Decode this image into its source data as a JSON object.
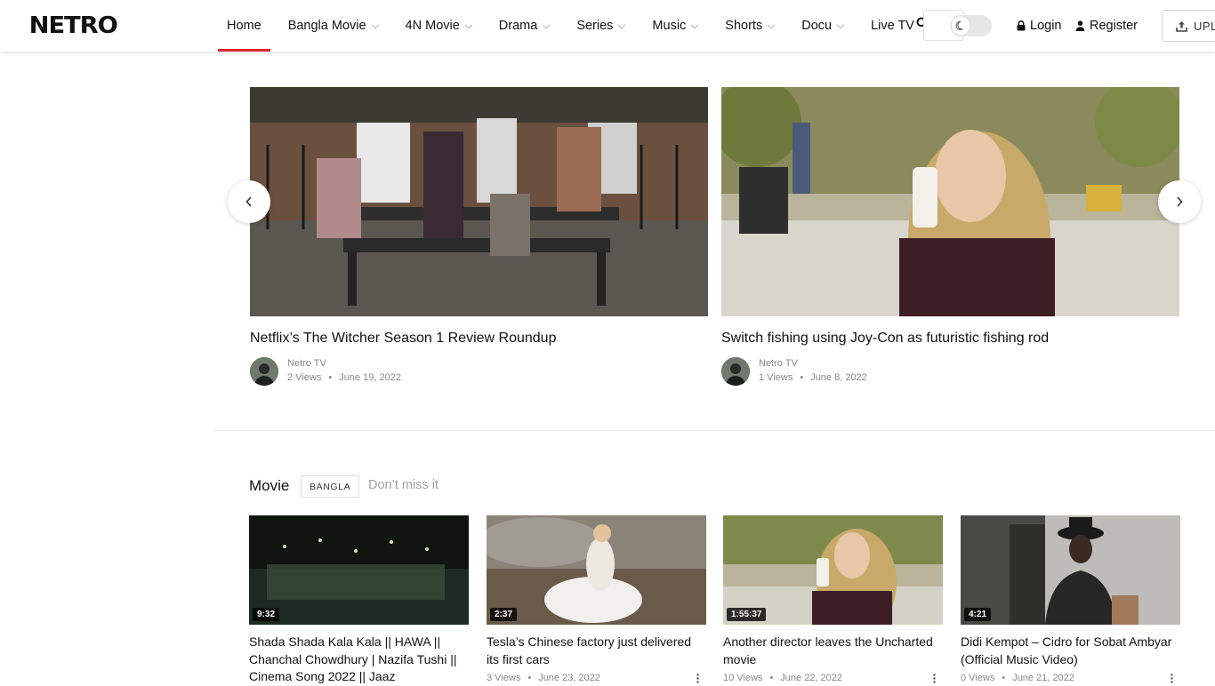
{
  "header": {
    "logo": "NETRO",
    "nav": [
      {
        "label": "Home",
        "has_dropdown": false,
        "active": true
      },
      {
        "label": "Bangla Movie",
        "has_dropdown": true
      },
      {
        "label": "4N Movie",
        "has_dropdown": true
      },
      {
        "label": "Drama",
        "has_dropdown": true
      },
      {
        "label": "Series",
        "has_dropdown": true
      },
      {
        "label": "Music",
        "has_dropdown": true
      },
      {
        "label": "Shorts",
        "has_dropdown": true
      },
      {
        "label": "Docu",
        "has_dropdown": true
      },
      {
        "label": "Live TV",
        "has_dropdown": false
      }
    ],
    "login_label": "Login",
    "register_label": "Register",
    "upload_label": "UPL"
  },
  "featured": [
    {
      "title": "Netflix’s The Witcher Season 1 Review Roundup",
      "channel": "Netro TV",
      "views": "2 Views",
      "date": "June 19, 2022"
    },
    {
      "title": "Switch fishing using Joy-Con as futuristic fishing rod",
      "channel": "Netro TV",
      "views": "1 Views",
      "date": "June 8, 2022"
    }
  ],
  "section": {
    "title": "Movie",
    "tag": "BANGLA",
    "subtitle": "Don’t miss it",
    "cards": [
      {
        "duration": "9:32",
        "title": "Shada Shada Kala Kala || HAWA || Chanchal Chowdhury | Nazifa Tushi || Cinema Song 2022 || Jaaz",
        "views": "",
        "date": ""
      },
      {
        "duration": "2:37",
        "title": "Tesla’s Chinese factory just delivered its first cars",
        "views": "3 Views",
        "date": "June 23, 2022"
      },
      {
        "duration": "1:55:37",
        "title": "Another director leaves the Uncharted movie",
        "views": "10 Views",
        "date": "June 22, 2022"
      },
      {
        "duration": "4:21",
        "title": "Didi Kempot – Cidro for Sobat Ambyar (Official Music Video)",
        "views": "0 Views",
        "date": "June 21, 2022"
      }
    ]
  },
  "colors": {
    "accent": "#e2282f"
  },
  "icons": [
    "search-icon",
    "moon-icon",
    "lock-icon",
    "user-icon",
    "upload-icon",
    "chevron-left-icon",
    "chevron-right-icon",
    "more-vertical-icon"
  ]
}
